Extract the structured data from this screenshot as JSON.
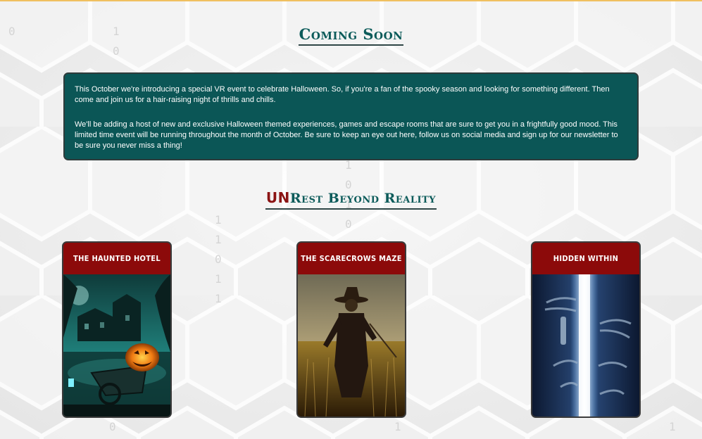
{
  "coming_soon": {
    "heading": "Coming Soon",
    "paragraphs": [
      "This October we're introducing a special VR event to celebrate Halloween. So, if you're a fan of the spooky season and looking for something different. Then come and join us for a hair-raising night of thrills and chills.",
      "We'll be adding a host of new and exclusive Halloween themed experiences, games and escape rooms that are sure to get you in a frightfully good mood. This limited time event will be running throughout the month of October. Be sure to keep an eye out here, follow us on social media and sign up for our newsletter to be sure you never miss a thing!"
    ]
  },
  "unrest": {
    "logo_prefix": "UN",
    "heading_rest": "Rest Beyond Reality"
  },
  "cards": [
    {
      "title": "The Haunted Hotel"
    },
    {
      "title": "The Scarecrows Maze"
    },
    {
      "title": "Hidden Within"
    }
  ],
  "colors": {
    "accent_teal": "#0b5656",
    "card_header_red": "#8c0a0a",
    "logo_red": "#8b1414",
    "top_border": "#f0c060"
  },
  "background": {
    "binary_digits": [
      "0",
      "1",
      "0",
      "1",
      "0",
      "1",
      "0",
      "1",
      "1",
      "0",
      "1",
      "1",
      "0",
      "1",
      "1"
    ]
  }
}
